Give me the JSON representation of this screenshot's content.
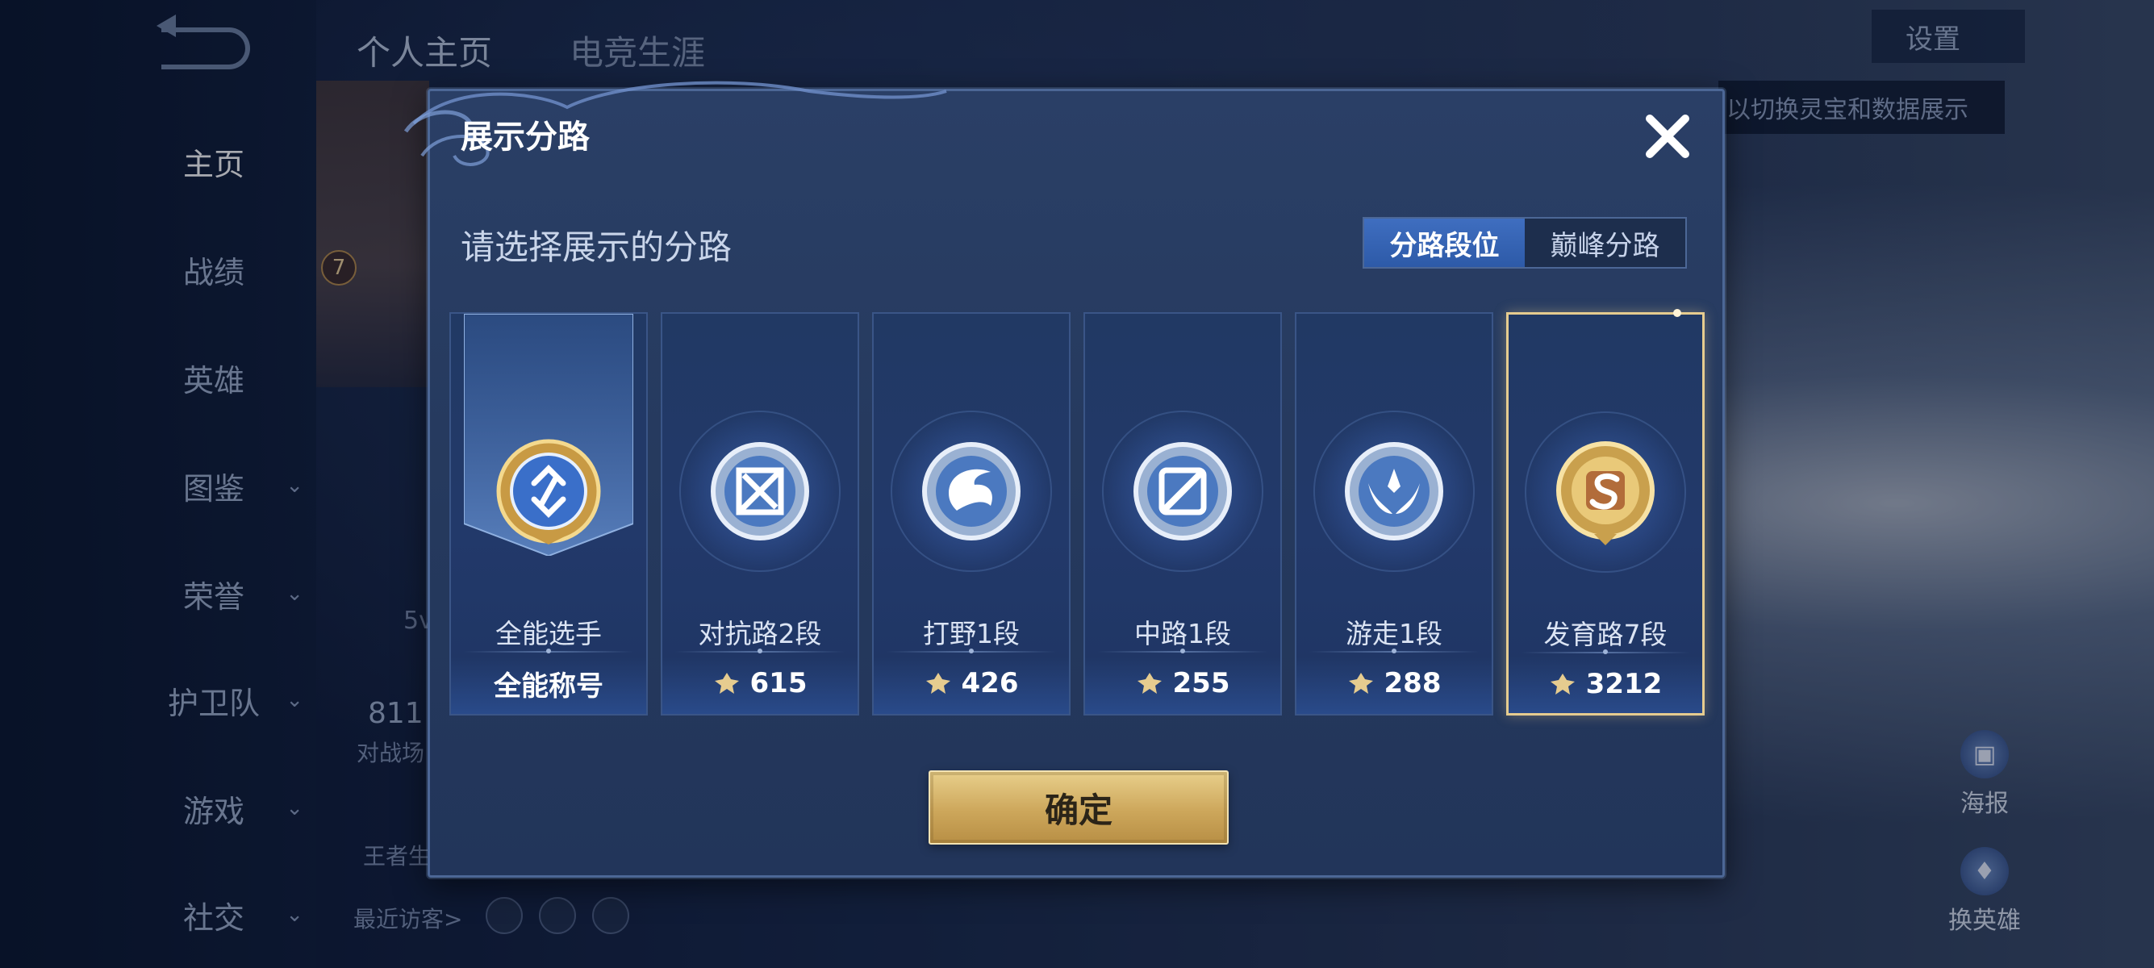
{
  "background": {
    "back_label": "",
    "top_tabs": [
      "个人主页",
      "电竞生涯"
    ],
    "settings_label": "设置",
    "hint_text": "以切换灵宝和数据展示",
    "nav": [
      {
        "label": "主页",
        "chevron": false,
        "active": true
      },
      {
        "label": "战绩",
        "chevron": false
      },
      {
        "label": "英雄",
        "chevron": false
      },
      {
        "label": "图鉴",
        "chevron": true
      },
      {
        "label": "荣誉",
        "chevron": true
      },
      {
        "label": "护卫队",
        "chevron": true
      },
      {
        "label": "游戏",
        "chevron": true
      },
      {
        "label": "社交",
        "chevron": true
      }
    ],
    "side_buttons": [
      {
        "label": "海报",
        "icon": "poster-icon"
      },
      {
        "label": "换英雄",
        "icon": "swap-hero-icon"
      }
    ],
    "recent_visitors": "最近访客>",
    "partial_texts": {
      "player_level": "7",
      "mode": "5v",
      "score": "811",
      "score_label": "对战场",
      "bottom_label": "王者生"
    }
  },
  "dialog": {
    "title": "展示分路",
    "subtitle": "请选择展示的分路",
    "toggle": {
      "options": [
        "分路段位",
        "巅峰分路"
      ],
      "selected": 0
    },
    "cards": [
      {
        "name": "全能选手",
        "value": "全能称号",
        "emblem": "all-round-emblem",
        "type": "banner",
        "has_points": false
      },
      {
        "name": "对抗路2段",
        "value": "615",
        "emblem": "clash-lane-emblem",
        "has_points": true
      },
      {
        "name": "打野1段",
        "value": "426",
        "emblem": "jungle-emblem",
        "has_points": true
      },
      {
        "name": "中路1段",
        "value": "255",
        "emblem": "mid-lane-emblem",
        "has_points": true
      },
      {
        "name": "游走1段",
        "value": "288",
        "emblem": "roam-emblem",
        "has_points": true
      },
      {
        "name": "发育路7段",
        "value": "3212",
        "emblem": "farm-lane-emblem",
        "has_points": true,
        "selected": true
      }
    ],
    "confirm_label": "确定"
  },
  "colors": {
    "gold": "#e6cc8f",
    "accent_blue": "#3f6ec0",
    "dialog_bg": "#26395e"
  }
}
